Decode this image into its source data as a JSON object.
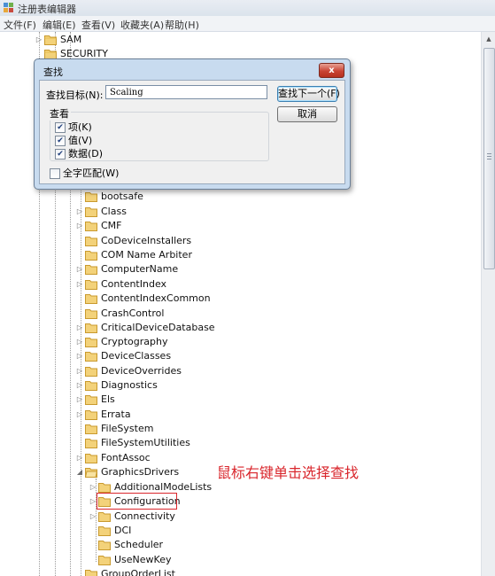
{
  "window": {
    "title": "注册表编辑器"
  },
  "menu": [
    {
      "label": "文件(F)"
    },
    {
      "label": "编辑(E)"
    },
    {
      "label": "查看(V)"
    },
    {
      "label": "收藏夹(A)"
    },
    {
      "label": "帮助(H)"
    }
  ],
  "tree": {
    "top_items": [
      {
        "label": "SAM"
      },
      {
        "label": "SECURITY"
      }
    ],
    "items": [
      {
        "label": "bootsafe"
      },
      {
        "label": "Class"
      },
      {
        "label": "CMF"
      },
      {
        "label": "CoDeviceInstallers"
      },
      {
        "label": "COM Name Arbiter"
      },
      {
        "label": "ComputerName"
      },
      {
        "label": "ContentIndex"
      },
      {
        "label": "ContentIndexCommon"
      },
      {
        "label": "CrashControl"
      },
      {
        "label": "CriticalDeviceDatabase"
      },
      {
        "label": "Cryptography"
      },
      {
        "label": "DeviceClasses"
      },
      {
        "label": "DeviceOverrides"
      },
      {
        "label": "Diagnostics"
      },
      {
        "label": "Els"
      },
      {
        "label": "Errata"
      },
      {
        "label": "FileSystem"
      },
      {
        "label": "FileSystemUtilities"
      },
      {
        "label": "FontAssoc"
      },
      {
        "label": "GraphicsDrivers"
      }
    ],
    "children": [
      {
        "label": "AdditionalModeLists"
      },
      {
        "label": "Configuration"
      },
      {
        "label": "Connectivity"
      },
      {
        "label": "DCI"
      },
      {
        "label": "Scheduler"
      },
      {
        "label": "UseNewKey"
      }
    ],
    "last_item": {
      "label": "GroupOrderList"
    }
  },
  "annotation": {
    "text": "鼠标右键单击选择查找",
    "color": "#d9262c"
  },
  "find_dialog": {
    "title": "查找",
    "close_label": "x",
    "target_label": "查找目标(N):",
    "target_value": "Scaling",
    "find_next_label": "查找下一个(F)",
    "cancel_label": "取消",
    "look_at_label": "查看",
    "options": [
      {
        "label": "项(K)",
        "checked": true
      },
      {
        "label": "值(V)",
        "checked": true
      },
      {
        "label": "数据(D)",
        "checked": true
      }
    ],
    "whole_match_label": "全字匹配(W)",
    "whole_match_checked": false
  },
  "colors": {
    "folder": "#e9c15a",
    "dialog_frame": "#c8dbef",
    "highlight": "#d9262c"
  }
}
